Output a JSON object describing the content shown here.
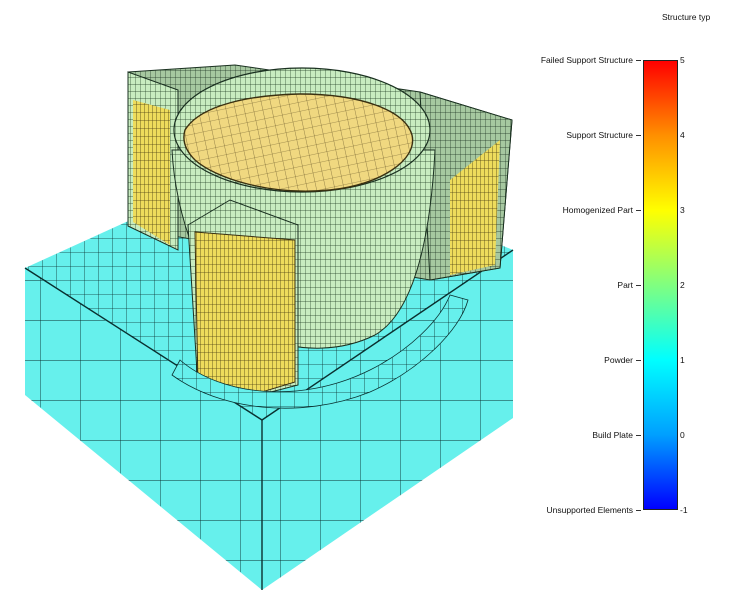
{
  "legend": {
    "title": "Structure typ",
    "categories": [
      {
        "label": "Failed Support Structure",
        "value": "5"
      },
      {
        "label": "Support Structure",
        "value": "4"
      },
      {
        "label": "Homogenized Part",
        "value": "3"
      },
      {
        "label": "Part",
        "value": "2"
      },
      {
        "label": "Powder",
        "value": "1"
      },
      {
        "label": "Build Plate",
        "value": "0"
      },
      {
        "label": "Unsupported Elements",
        "value": "-1"
      }
    ],
    "scale_min": -1,
    "scale_max": 5,
    "colormap": [
      "#0000ff",
      "#00a0ff",
      "#00ffff",
      "#80ff80",
      "#ffff00",
      "#ff9000",
      "#ff0000"
    ]
  },
  "colors": {
    "build_plate": "#66f0ec",
    "part": "#c8ecc0",
    "homogenized_part": "#e8d870",
    "support_structure": "#f0e460",
    "mesh_line": "#0a2a2a"
  }
}
